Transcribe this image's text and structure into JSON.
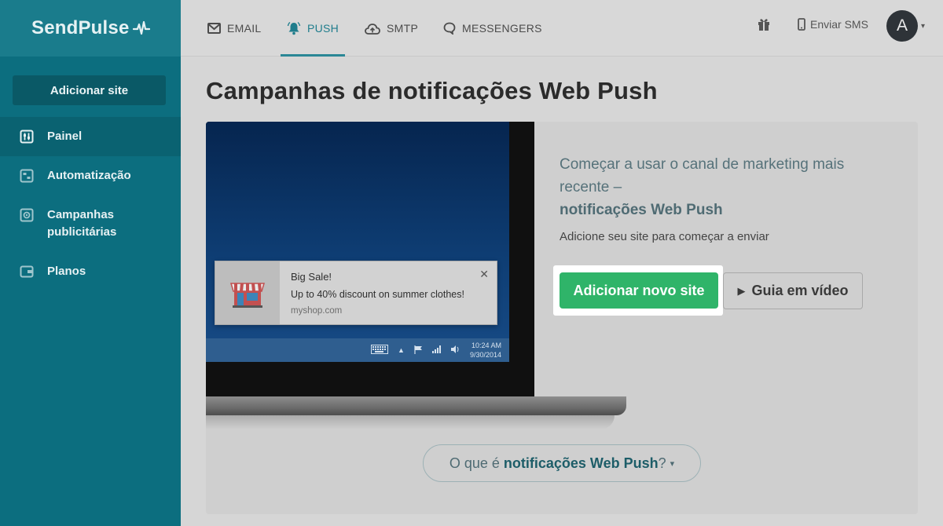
{
  "logo": {
    "text": "SendPulse"
  },
  "sidebar": {
    "add_site_label": "Adicionar site",
    "items": [
      {
        "label": "Painel",
        "icon": "sliders-icon",
        "active": true
      },
      {
        "label": "Automatização",
        "icon": "automation-icon",
        "active": false
      },
      {
        "label": "Campanhas publicitárias",
        "icon": "campaign-icon",
        "active": false
      },
      {
        "label": "Planos",
        "icon": "wallet-icon",
        "active": false
      }
    ]
  },
  "topbar": {
    "tabs": [
      {
        "label": "EMAIL",
        "icon": "envelope-icon",
        "active": false
      },
      {
        "label": "PUSH",
        "icon": "bell-icon",
        "active": true
      },
      {
        "label": "SMTP",
        "icon": "cloud-upload-icon",
        "active": false
      },
      {
        "label": "MESSENGERS",
        "icon": "chat-bubble-icon",
        "active": false
      }
    ],
    "gift_icon": "gift-icon",
    "sms_label": "Enviar SMS",
    "avatar_letter": "A"
  },
  "main": {
    "title": "Campanhas de notificações Web Push",
    "intro_line": "Começar a usar o canal de marketing mais recente –",
    "intro_strong": "notificações Web Push",
    "subtitle": "Adicione seu site para começar a enviar",
    "primary_button": "Adicionar novo site",
    "video_button": "Guia em vídeo",
    "faq_prefix": "O que é",
    "faq_strong": "notificações Web Push",
    "faq_suffix": "?"
  },
  "illustration": {
    "notification": {
      "title": "Big Sale!",
      "body": "Up to 40% discount on summer clothes!",
      "url": "myshop.com"
    },
    "clock_time": "10:24 AM",
    "clock_date": "9/30/2014"
  },
  "colors": {
    "sidebar_bg": "#0c6e7f",
    "accent": "#2a8796",
    "primary_button": "#2fb469"
  }
}
